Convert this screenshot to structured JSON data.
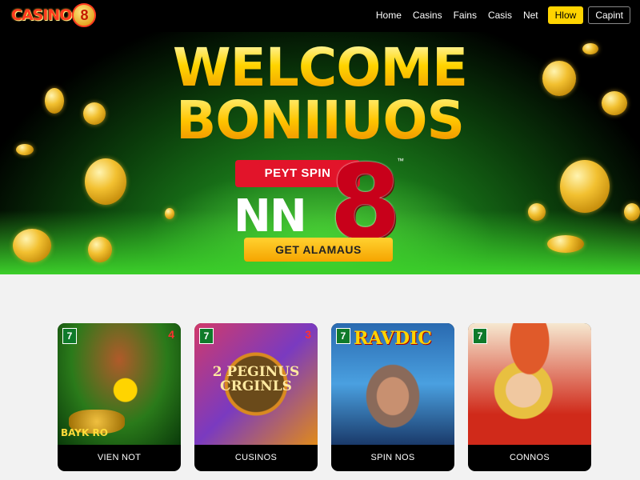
{
  "header": {
    "logo_text": "CASINO",
    "logo_badge": "8",
    "nav": [
      "Home",
      "Casins",
      "Fains",
      "Casis",
      "Net"
    ],
    "play_label": "Hlow",
    "cap_label": "Capint"
  },
  "hero": {
    "title_line1": "WELCOME",
    "title_line2": "BONIIUOS",
    "promo_label": "PEYT SPIN",
    "brand_text": "NN",
    "brand_number": "8",
    "trademark": "™",
    "cta_label": "GET ALAMAUS"
  },
  "games": [
    {
      "badge": "7",
      "corner": "4",
      "art_text": "BAYK  RO",
      "label": "VIEN NOT"
    },
    {
      "badge": "7",
      "corner": "3",
      "art_text": "2 PEGINUS CRGINLS",
      "label": "CUSINOS"
    },
    {
      "badge": "7",
      "corner": "",
      "art_text": "RAVDIC",
      "label": "SPIN NOS"
    },
    {
      "badge": "7",
      "corner": "",
      "art_text": "",
      "label": "CONNOS"
    }
  ],
  "colors": {
    "accent_yellow": "#ffd400",
    "promo_red": "#e2142a",
    "brand_red": "#c8001a",
    "hero_green": "#2fb52a"
  }
}
